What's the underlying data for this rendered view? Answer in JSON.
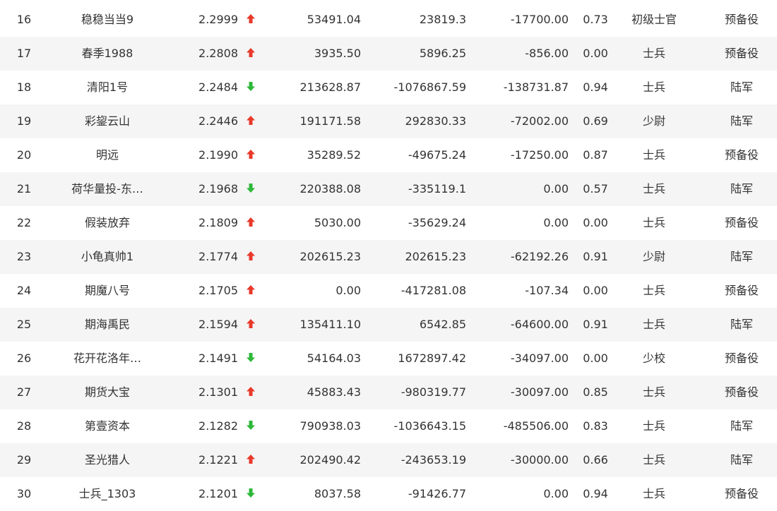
{
  "colors": {
    "up": "#e8392b",
    "down": "#2eb839",
    "row_alt": "#f5f5f5",
    "text": "#333333"
  },
  "rows": [
    {
      "rank": "16",
      "name": "稳稳当当9",
      "score": "2.2999",
      "trend": "up",
      "equity": "53491.04",
      "profit": "23819.3",
      "drawdown": "-17700.00",
      "ratio": "0.73",
      "title": "初级士官",
      "branch": "预备役"
    },
    {
      "rank": "17",
      "name": "春季1988",
      "score": "2.2808",
      "trend": "up",
      "equity": "3935.50",
      "profit": "5896.25",
      "drawdown": "-856.00",
      "ratio": "0.00",
      "title": "士兵",
      "branch": "预备役"
    },
    {
      "rank": "18",
      "name": "清阳1号",
      "score": "2.2484",
      "trend": "down",
      "equity": "213628.87",
      "profit": "-1076867.59",
      "drawdown": "-138731.87",
      "ratio": "0.94",
      "title": "士兵",
      "branch": "陆军"
    },
    {
      "rank": "19",
      "name": "彩鋆云山",
      "score": "2.2446",
      "trend": "up",
      "equity": "191171.58",
      "profit": "292830.33",
      "drawdown": "-72002.00",
      "ratio": "0.69",
      "title": "少尉",
      "branch": "陆军"
    },
    {
      "rank": "20",
      "name": "明远",
      "score": "2.1990",
      "trend": "up",
      "equity": "35289.52",
      "profit": "-49675.24",
      "drawdown": "-17250.00",
      "ratio": "0.87",
      "title": "士兵",
      "branch": "预备役"
    },
    {
      "rank": "21",
      "name": "荷华量投-东…",
      "score": "2.1968",
      "trend": "down",
      "equity": "220388.08",
      "profit": "-335119.1",
      "drawdown": "0.00",
      "ratio": "0.57",
      "title": "士兵",
      "branch": "陆军"
    },
    {
      "rank": "22",
      "name": "假装放弃",
      "score": "2.1809",
      "trend": "up",
      "equity": "5030.00",
      "profit": "-35629.24",
      "drawdown": "0.00",
      "ratio": "0.00",
      "title": "士兵",
      "branch": "预备役"
    },
    {
      "rank": "23",
      "name": "小龟真帅1",
      "score": "2.1774",
      "trend": "up",
      "equity": "202615.23",
      "profit": "202615.23",
      "drawdown": "-62192.26",
      "ratio": "0.91",
      "title": "少尉",
      "branch": "陆军"
    },
    {
      "rank": "24",
      "name": "期魔八号",
      "score": "2.1705",
      "trend": "up",
      "equity": "0.00",
      "profit": "-417281.08",
      "drawdown": "-107.34",
      "ratio": "0.00",
      "title": "士兵",
      "branch": "预备役"
    },
    {
      "rank": "25",
      "name": "期海禹民",
      "score": "2.1594",
      "trend": "up",
      "equity": "135411.10",
      "profit": "6542.85",
      "drawdown": "-64600.00",
      "ratio": "0.91",
      "title": "士兵",
      "branch": "陆军"
    },
    {
      "rank": "26",
      "name": "花开花洛年…",
      "score": "2.1491",
      "trend": "down",
      "equity": "54164.03",
      "profit": "1672897.42",
      "drawdown": "-34097.00",
      "ratio": "0.00",
      "title": "少校",
      "branch": "预备役"
    },
    {
      "rank": "27",
      "name": "期货大宝",
      "score": "2.1301",
      "trend": "up",
      "equity": "45883.43",
      "profit": "-980319.77",
      "drawdown": "-30097.00",
      "ratio": "0.85",
      "title": "士兵",
      "branch": "预备役"
    },
    {
      "rank": "28",
      "name": "第壹资本",
      "score": "2.1282",
      "trend": "down",
      "equity": "790938.03",
      "profit": "-1036643.15",
      "drawdown": "-485506.00",
      "ratio": "0.83",
      "title": "士兵",
      "branch": "陆军"
    },
    {
      "rank": "29",
      "name": "圣光猎人",
      "score": "2.1221",
      "trend": "up",
      "equity": "202490.42",
      "profit": "-243653.19",
      "drawdown": "-30000.00",
      "ratio": "0.66",
      "title": "士兵",
      "branch": "陆军"
    },
    {
      "rank": "30",
      "name": "士兵_1303",
      "score": "2.1201",
      "trend": "down",
      "equity": "8037.58",
      "profit": "-91426.77",
      "drawdown": "0.00",
      "ratio": "0.94",
      "title": "士兵",
      "branch": "预备役"
    }
  ]
}
